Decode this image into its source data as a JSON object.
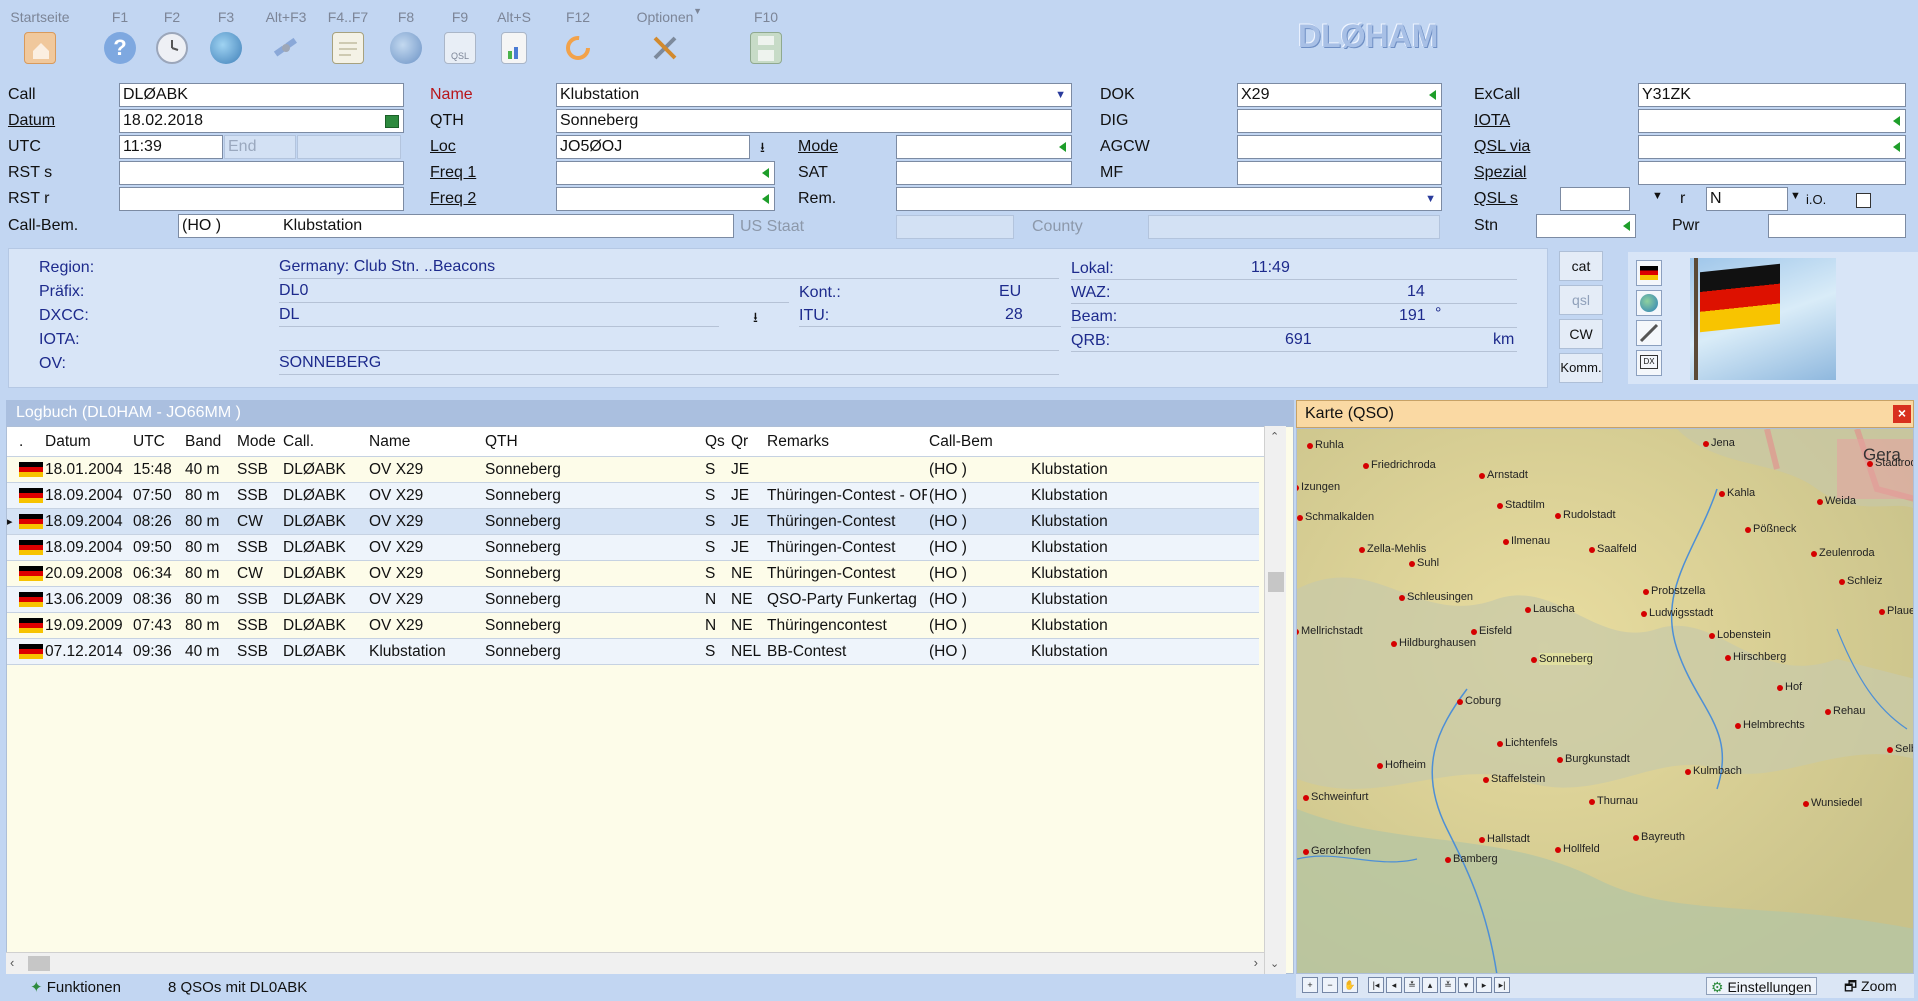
{
  "toolbar": {
    "items": [
      {
        "label": "Startseite",
        "icon": "home-icon"
      },
      {
        "label": "F1",
        "icon": "help-icon"
      },
      {
        "label": "F2",
        "icon": "clock-icon"
      },
      {
        "label": "F3",
        "icon": "globe-icon"
      },
      {
        "label": "Alt+F3",
        "icon": "satellite-icon"
      },
      {
        "label": "F4..F7",
        "icon": "notepad-icon"
      },
      {
        "label": "F8",
        "icon": "web-globe-icon"
      },
      {
        "label": "F9",
        "icon": "qsl-card-icon",
        "sublabel": "QSL"
      },
      {
        "label": "Alt+S",
        "icon": "stats-document-icon"
      },
      {
        "label": "F12",
        "icon": "refresh-icon"
      },
      {
        "label": "Optionen",
        "icon": "tools-icon"
      },
      {
        "label": "F10",
        "icon": "save-icon"
      }
    ],
    "brand": "DLØHAM"
  },
  "form": {
    "call": {
      "label": "Call",
      "value": "DLØABK"
    },
    "datum": {
      "label": "Datum",
      "value": "18.02.2018"
    },
    "utc": {
      "label": "UTC",
      "value": "11:39",
      "end_placeholder": "End"
    },
    "rst_s": {
      "label": "RST s",
      "value": ""
    },
    "rst_r": {
      "label": "RST r",
      "value": ""
    },
    "call_bem": {
      "label": "Call-Bem.",
      "value_a": "(HO )",
      "value_b": "Klubstation"
    },
    "name": {
      "label": "Name",
      "value": "Klubstation"
    },
    "qth": {
      "label": "QTH",
      "value": "Sonneberg"
    },
    "loc": {
      "label": "Loc",
      "value": "JO5ØOJ"
    },
    "mode": {
      "label": "Mode",
      "value": ""
    },
    "freq1": {
      "label": "Freq 1",
      "value": ""
    },
    "sat": {
      "label": "SAT",
      "value": ""
    },
    "freq2": {
      "label": "Freq 2",
      "value": ""
    },
    "rem": {
      "label": "Rem.",
      "value": ""
    },
    "us_staat": {
      "label": "US Staat",
      "value": ""
    },
    "county": {
      "label": "County",
      "value": ""
    },
    "dok": {
      "label": "DOK",
      "value": "X29"
    },
    "dig": {
      "label": "DIG",
      "value": ""
    },
    "agcw": {
      "label": "AGCW",
      "value": ""
    },
    "mf": {
      "label": "MF",
      "value": ""
    },
    "excall": {
      "label": "ExCall",
      "value": "Y31ZK"
    },
    "iota": {
      "label": "IOTA",
      "value": ""
    },
    "qsl_via": {
      "label": "QSL via",
      "value": ""
    },
    "spezial": {
      "label": "Spezial",
      "value": ""
    },
    "qsl_s": {
      "label": "QSL s",
      "value": "",
      "r_label": "r",
      "r_value": "N",
      "io_label": "i.O."
    },
    "stn": {
      "label": "Stn",
      "value": ""
    },
    "pwr": {
      "label": "Pwr",
      "value": ""
    }
  },
  "info": {
    "region_label": "Region:",
    "region": "Germany: Club Stn. ..Beacons",
    "praefix_label": "Präfix:",
    "praefix": "DL0",
    "dxcc_label": "DXCC:",
    "dxcc": "DL",
    "iota_label": "IOTA:",
    "iota": "",
    "ov_label": "OV:",
    "ov": "SONNEBERG",
    "kont_label": "Kont.:",
    "kont": "EU",
    "itu_label": "ITU:",
    "itu": "28",
    "lokal_label": "Lokal:",
    "lokal": "11:49",
    "waz_label": "WAZ:",
    "waz": "14",
    "beam_label": "Beam:",
    "beam": "191",
    "beam_unit": "°",
    "qrb_label": "QRB:",
    "qrb": "691",
    "qrb_unit": "km",
    "buttons": [
      "cat",
      "qsl",
      "CW",
      "Komm."
    ]
  },
  "log": {
    "title": "Logbuch  (DL0HAM - JO66MM )",
    "columns": [
      ".",
      "Datum",
      "UTC",
      "Band",
      "Mode",
      "Call.",
      "Name",
      "QTH",
      "Qs",
      "Qr",
      "Remarks",
      "Call-Bem"
    ],
    "rows": [
      {
        "datum": "18.01.2004",
        "utc": "15:48",
        "band": "40 m",
        "mode": "SSB",
        "call": "DLØABK",
        "name": "OV X29",
        "qth": "Sonneberg",
        "qs": "S",
        "qr": "JE",
        "remarks": "",
        "callbem": "(HO )",
        "callbem2": "Klubstation"
      },
      {
        "datum": "18.09.2004",
        "utc": "07:50",
        "band": "80 m",
        "mode": "SSB",
        "call": "DLØABK",
        "name": "OV X29",
        "qth": "Sonneberg",
        "qs": "S",
        "qr": "JE",
        "remarks": "Thüringen-Contest  -  OF",
        "callbem": "(HO )",
        "callbem2": "Klubstation"
      },
      {
        "datum": "18.09.2004",
        "utc": "08:26",
        "band": "80 m",
        "mode": "CW",
        "call": "DLØABK",
        "name": "OV X29",
        "qth": "Sonneberg",
        "qs": "S",
        "qr": "JE",
        "remarks": "Thüringen-Contest",
        "callbem": "(HO )",
        "callbem2": "Klubstation"
      },
      {
        "datum": "18.09.2004",
        "utc": "09:50",
        "band": "80 m",
        "mode": "SSB",
        "call": "DLØABK",
        "name": "OV X29",
        "qth": "Sonneberg",
        "qs": "S",
        "qr": "JE",
        "remarks": "Thüringen-Contest",
        "callbem": "(HO )",
        "callbem2": "Klubstation"
      },
      {
        "datum": "20.09.2008",
        "utc": "06:34",
        "band": "80 m",
        "mode": "CW",
        "call": "DLØABK",
        "name": "OV X29",
        "qth": "Sonneberg",
        "qs": "S",
        "qr": "NE",
        "remarks": "Thüringen-Contest",
        "callbem": "(HO )",
        "callbem2": "Klubstation"
      },
      {
        "datum": "13.06.2009",
        "utc": "08:36",
        "band": "80 m",
        "mode": "SSB",
        "call": "DLØABK",
        "name": "OV X29",
        "qth": "Sonneberg",
        "qs": "N",
        "qr": "NE",
        "remarks": "QSO-Party Funkertag",
        "callbem": "(HO )",
        "callbem2": "Klubstation"
      },
      {
        "datum": "19.09.2009",
        "utc": "07:43",
        "band": "80 m",
        "mode": "SSB",
        "call": "DLØABK",
        "name": "OV X29",
        "qth": "Sonneberg",
        "qs": "N",
        "qr": "NE",
        "remarks": "Thüringencontest",
        "callbem": "(HO )",
        "callbem2": "Klubstation"
      },
      {
        "datum": "07.12.2014",
        "utc": "09:36",
        "band": "40 m",
        "mode": "SSB",
        "call": "DLØABK",
        "name": "Klubstation",
        "qth": "Sonneberg",
        "qs": "S",
        "qr": "NEL",
        "remarks": "BB-Contest",
        "callbem": "(HO )",
        "callbem2": "Klubstation"
      }
    ]
  },
  "map": {
    "title": "Karte (QSO)",
    "cities": [
      "Jena",
      "Gera",
      "Ruhla",
      "Friedrichroda",
      "Arnstadt",
      "Stadtroda",
      "Izungen",
      "Kahla",
      "Stadtilm",
      "Schmalkalden",
      "Rudolstadt",
      "Weida",
      "Pößneck",
      "Ilmenau",
      "Zella-Mehlis",
      "Saalfeld",
      "Zeulenroda",
      "Suhl",
      "Schleiz",
      "Schleusingen",
      "Probstzella",
      "Lauscha",
      "Ludwigsstadt",
      "Plaue",
      "Mellrichstadt",
      "Eisfeld",
      "Lobenstein",
      "Hildburghausen",
      "Hirschberg",
      "Sonneberg",
      "Hof",
      "Coburg",
      "Rehau",
      "Helmbrechts",
      "Lichtenfels",
      "Burgkunstadt",
      "Selb",
      "Hofheim",
      "Kulmbach",
      "Staffelstein",
      "Schweinfurt",
      "Thurnau",
      "Wunsiedel",
      "Hallstadt",
      "Bayreuth",
      "Gerolzhofen",
      "Hollfeld",
      "Bamberg"
    ],
    "settings_label": "Einstellungen",
    "zoom_label": "Zoom"
  },
  "status": {
    "funktionen": "Funktionen",
    "count": "8 QSOs mit DL0ABK"
  }
}
